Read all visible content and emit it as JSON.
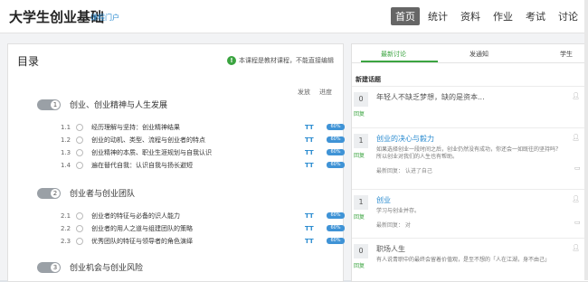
{
  "header": {
    "title": "大学生创业基础",
    "portal": "课程门户",
    "nav": [
      "首页",
      "统计",
      "资料",
      "作业",
      "考试",
      "讨论"
    ]
  },
  "catalog": {
    "title": "目录",
    "notice": "本课程是教材课程，不能直接编辑",
    "col_publish": "发放",
    "col_progress": "进度",
    "chapters": [
      {
        "num": "1",
        "name": "创业、创业精神与人生发展",
        "sections": [
          {
            "no": "1.1",
            "name": "经历理解与坚持：创业精神结果",
            "pub": "TT",
            "prog": "60%"
          },
          {
            "no": "1.2",
            "name": "创业的动机、类型、流程与创业者的特点",
            "pub": "TT",
            "prog": "60%"
          },
          {
            "no": "1.3",
            "name": "创业精神的本质、职业生涯规划与自我认识",
            "pub": "TT",
            "prog": "60%"
          },
          {
            "no": "1.4",
            "name": "遍在替代自我：认识自我与扬长避短",
            "pub": "TT",
            "prog": "60%"
          }
        ]
      },
      {
        "num": "2",
        "name": "创业者与创业团队",
        "sections": [
          {
            "no": "2.1",
            "name": "创业者的特征与必备的识人能力",
            "pub": "TT",
            "prog": "60%"
          },
          {
            "no": "2.2",
            "name": "创业者的用人之道与组建团队的策略",
            "pub": "TT",
            "prog": "60%"
          },
          {
            "no": "2.3",
            "name": "优秀团队的特征与领导者的角色演绎",
            "pub": "TT",
            "prog": "60%"
          }
        ]
      },
      {
        "num": "3",
        "name": "创业机会与创业风险",
        "sections": []
      }
    ]
  },
  "discussion": {
    "tabs": [
      "最新讨论",
      "发通知",
      "学生"
    ],
    "new_topic_label": "新建话题",
    "topics": [
      {
        "count": "0",
        "reply": "回复",
        "title": "年轻人不缺乏梦想，缺的是资本...",
        "sub": "",
        "meta": ""
      },
      {
        "count": "1",
        "reply": "回复",
        "title": "创业的决心与毅力",
        "sub": "如果选择创业一段时间之后，创业仍然没有成功，你还会一如既往的坚持吗？所以创业对我们的人生也有帮助。",
        "meta": "最新回复：  认进了自己"
      },
      {
        "count": "1",
        "reply": "回复",
        "title": "创业",
        "sub": "学习与创业并存。",
        "meta": "最新回复：  对"
      },
      {
        "count": "0",
        "reply": "回复",
        "title": "职场人生",
        "sub": "有人说青职中的最终会留着价值观，是至不想的「人在江湖，身不由己」",
        "meta": ""
      }
    ]
  },
  "colors": {
    "accent_green": "#3ba440",
    "link_blue": "#2a8bd0",
    "progress_blue": "#3f93d6",
    "nav_active_bg": "#666666"
  },
  "icons": {
    "notice": "info-icon",
    "user": "user-icon",
    "comment": "comment-icon"
  }
}
